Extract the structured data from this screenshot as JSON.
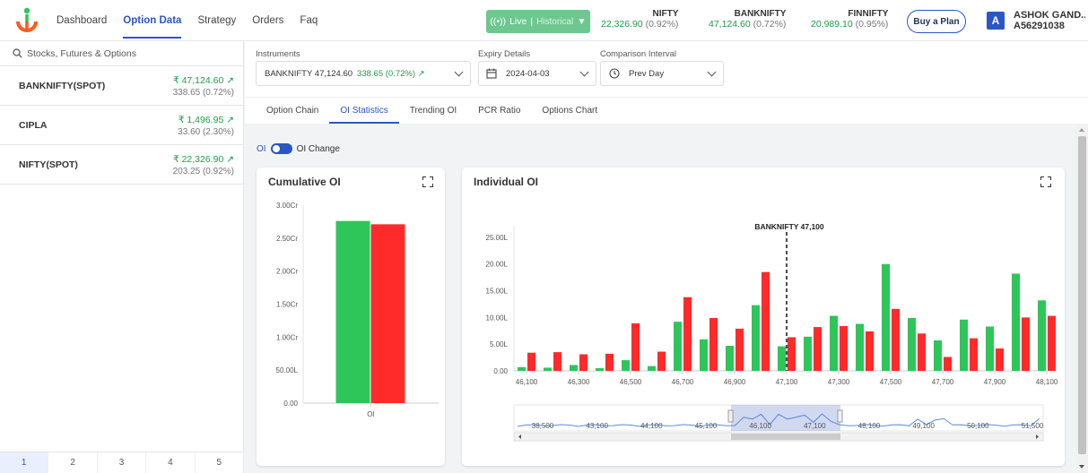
{
  "nav": {
    "items": [
      {
        "label": "Dashboard",
        "active": false
      },
      {
        "label": "Option Data",
        "active": true
      },
      {
        "label": "Strategy",
        "active": false
      },
      {
        "label": "Orders",
        "active": false
      },
      {
        "label": "Faq",
        "active": false
      }
    ],
    "live_label": "Live",
    "historical_label": "Historical",
    "indices": [
      {
        "name": "NIFTY",
        "value": "22,326.90",
        "change": "(0.92%)"
      },
      {
        "name": "BANKNIFTY",
        "value": "47,124.60",
        "change": "(0.72%)"
      },
      {
        "name": "FINNIFTY",
        "value": "20,989.10",
        "change": "(0.95%)"
      }
    ],
    "buy_label": "Buy a Plan",
    "avatar_letter": "A",
    "user_name": "ASHOK GAND...",
    "user_id": "A56291038"
  },
  "sidebar": {
    "search_placeholder": "Stocks, Futures & Options",
    "stocks": [
      {
        "name": "BANKNIFTY(SPOT)",
        "price": "₹ 47,124.60 ↗",
        "change": "338.65 (0.72%)"
      },
      {
        "name": "CIPLA",
        "price": "₹ 1,496.95 ↗",
        "change": "33.60 (2.30%)"
      },
      {
        "name": "NIFTY(SPOT)",
        "price": "₹ 22,326.90 ↗",
        "change": "203.25 (0.92%)"
      }
    ],
    "pages": [
      "1",
      "2",
      "3",
      "4",
      "5"
    ],
    "active_page": "1"
  },
  "filters": {
    "instruments_label": "Instruments",
    "instrument_name": "BANKNIFTY 47,124.60",
    "instrument_change": "338.65 (0.72%) ↗",
    "expiry_label": "Expiry Details",
    "expiry_value": "2024-04-03",
    "interval_label": "Comparison Interval",
    "interval_value": "Prev Day"
  },
  "tabs": [
    {
      "label": "Option Chain",
      "active": false
    },
    {
      "label": "OI Statistics",
      "active": true
    },
    {
      "label": "Trending OI",
      "active": false
    },
    {
      "label": "PCR Ratio",
      "active": false
    },
    {
      "label": "Options Chart",
      "active": false
    }
  ],
  "toggle": {
    "left": "OI",
    "right": "OI Change"
  },
  "colors": {
    "call": "#2ec659",
    "put": "#ff2b2b",
    "accent": "#2a56c6"
  },
  "chart_data": [
    {
      "type": "bar",
      "title": "Cumulative OI",
      "categories": [
        "OI"
      ],
      "series": [
        {
          "color": "#2ec659",
          "values": [
            27600000
          ]
        },
        {
          "color": "#ff2b2b",
          "values": [
            27100000
          ]
        }
      ],
      "yticks": [
        "0.00",
        "50.00L",
        "1.00Cr",
        "1.50Cr",
        "2.00Cr",
        "2.50Cr",
        "3.00Cr"
      ],
      "ylim": [
        0,
        30000000
      ],
      "grid": false
    },
    {
      "type": "bar",
      "title": "Individual OI",
      "categories": [
        "46,100",
        "46,200",
        "46,300",
        "46,400",
        "46,500",
        "46,600",
        "46,700",
        "46,800",
        "46,900",
        "47,000",
        "47,100",
        "47,200",
        "47,300",
        "47,400",
        "47,500",
        "47,600",
        "47,700",
        "47,800",
        "47,900",
        "48,000",
        "48,100"
      ],
      "xtick_labels": [
        "46,100",
        "46,300",
        "46,500",
        "46,700",
        "46,900",
        "47,100",
        "47,300",
        "47,500",
        "47,700",
        "47,900",
        "48,100"
      ],
      "series": [
        {
          "color": "#2ec659",
          "values": [
            0.7,
            0.6,
            1.1,
            0.5,
            2.0,
            0.9,
            9.2,
            5.9,
            4.7,
            12.3,
            4.6,
            6.4,
            10.3,
            8.8,
            20.0,
            9.9,
            5.7,
            9.6,
            8.3,
            18.2,
            13.2
          ]
        },
        {
          "color": "#ff2b2b",
          "values": [
            3.4,
            3.5,
            3.1,
            3.2,
            8.9,
            3.6,
            13.8,
            9.9,
            7.9,
            18.5,
            6.3,
            8.2,
            8.4,
            7.4,
            11.6,
            7.0,
            2.6,
            6.1,
            4.2,
            10.0,
            10.3
          ]
        }
      ],
      "yticks": [
        "0.00",
        "5.00L",
        "10.00L",
        "15.00L",
        "20.00L",
        "25.00L"
      ],
      "ylim": [
        0,
        27
      ],
      "annotation": {
        "label": "BANKNIFTY 47,100",
        "x": "47,100"
      },
      "navigator_labels": [
        "38,500",
        "43,100",
        "44,100",
        "45,100",
        "46,100",
        "47,100",
        "48,100",
        "49,100",
        "50,100",
        "51,500"
      ],
      "grid": false
    }
  ]
}
